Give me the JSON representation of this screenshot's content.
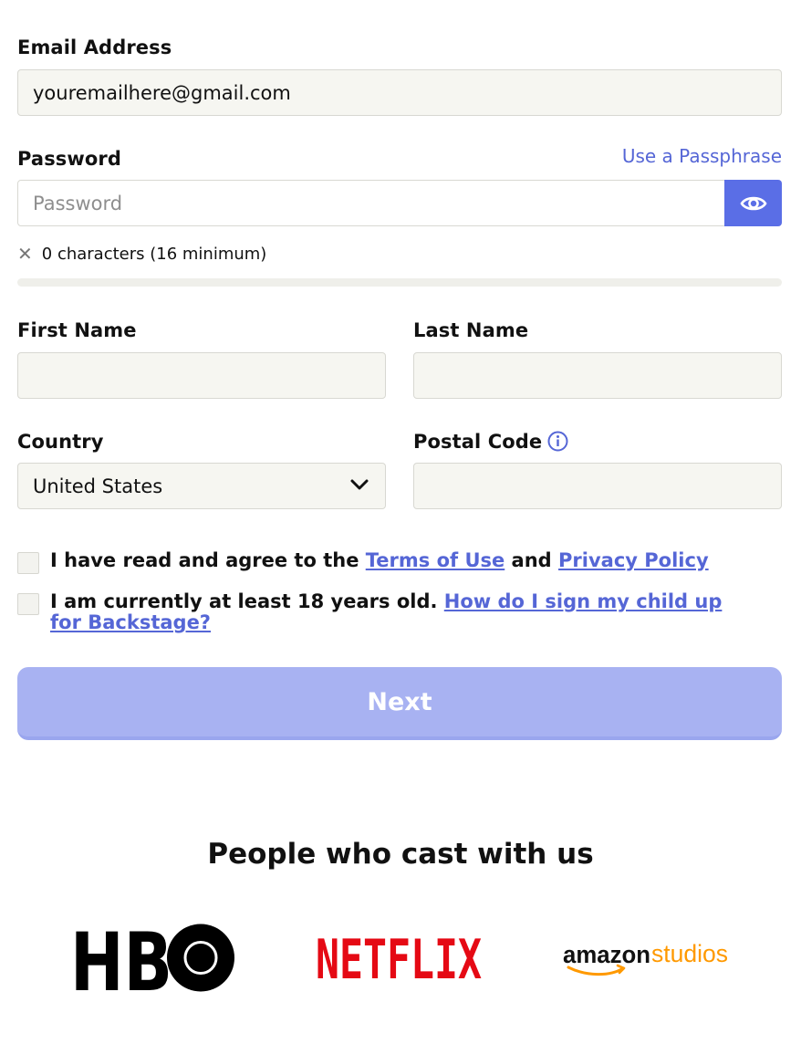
{
  "email": {
    "label": "Email Address",
    "value": "youremailhere@gmail.com"
  },
  "password": {
    "label": "Password",
    "placeholder": "Password",
    "passphrase_link": "Use a Passphrase",
    "hint": "0 characters (16 minimum)",
    "show_icon": "eye-icon"
  },
  "first_name": {
    "label": "First Name",
    "value": ""
  },
  "last_name": {
    "label": "Last Name",
    "value": ""
  },
  "country": {
    "label": "Country",
    "selected": "United States"
  },
  "postal_code": {
    "label": "Postal Code",
    "value": ""
  },
  "terms": {
    "text_before": "I have read and agree to the ",
    "terms_link": "Terms of Use",
    "text_mid": " and ",
    "privacy_link": "Privacy Policy"
  },
  "age": {
    "text": "I am currently at least 18 years old. ",
    "child_link": "How do I sign my child up for Backstage?"
  },
  "next_button": "Next",
  "partners": {
    "title": "People who cast with us",
    "logos": [
      {
        "name": "HBO",
        "text": "HB"
      },
      {
        "name": "NETFLIX",
        "text": "NETFLIX"
      },
      {
        "name": "amazonstudios",
        "text_a": "amazon",
        "text_b": "studios"
      }
    ]
  },
  "colors": {
    "accent": "#5a6ee6",
    "link": "#5566d6",
    "button_disabled": "#a8b2f2",
    "netflix_red": "#e50914",
    "amazon_orange": "#ff9900"
  }
}
